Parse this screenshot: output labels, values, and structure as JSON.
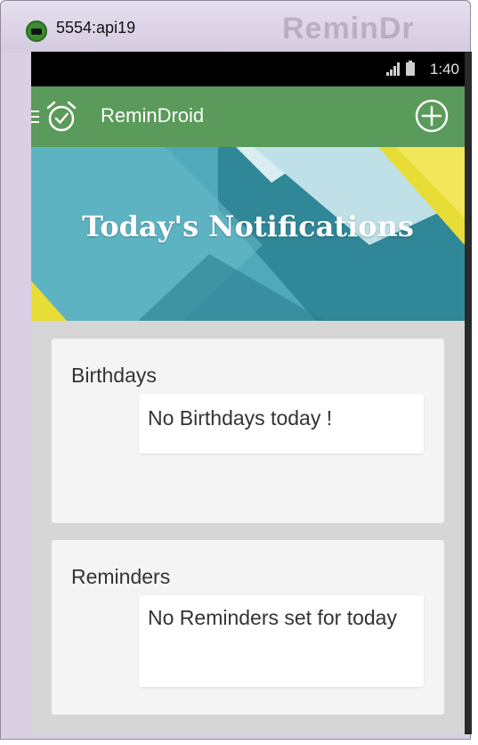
{
  "window": {
    "title": "5554:api19",
    "ghost_title": "ReminDr"
  },
  "statusbar": {
    "network_label": "3G",
    "time": "1:40"
  },
  "appbar": {
    "title": "ReminDroid",
    "menu_icon": "hamburger-icon",
    "logo_icon": "alarm-clock-icon",
    "action_icon": "plus-circle-icon"
  },
  "hero": {
    "title": "Today's Notifications"
  },
  "sections": {
    "birthdays": {
      "heading": "Birthdays",
      "message": "No Birthdays today  !"
    },
    "reminders": {
      "heading": "Reminders",
      "message": "No Reminders set for today"
    }
  },
  "colors": {
    "appbar": "#5a9a5a",
    "statusbar": "#000000",
    "background": "#d6d6d6",
    "card": "#f4f4f4"
  }
}
